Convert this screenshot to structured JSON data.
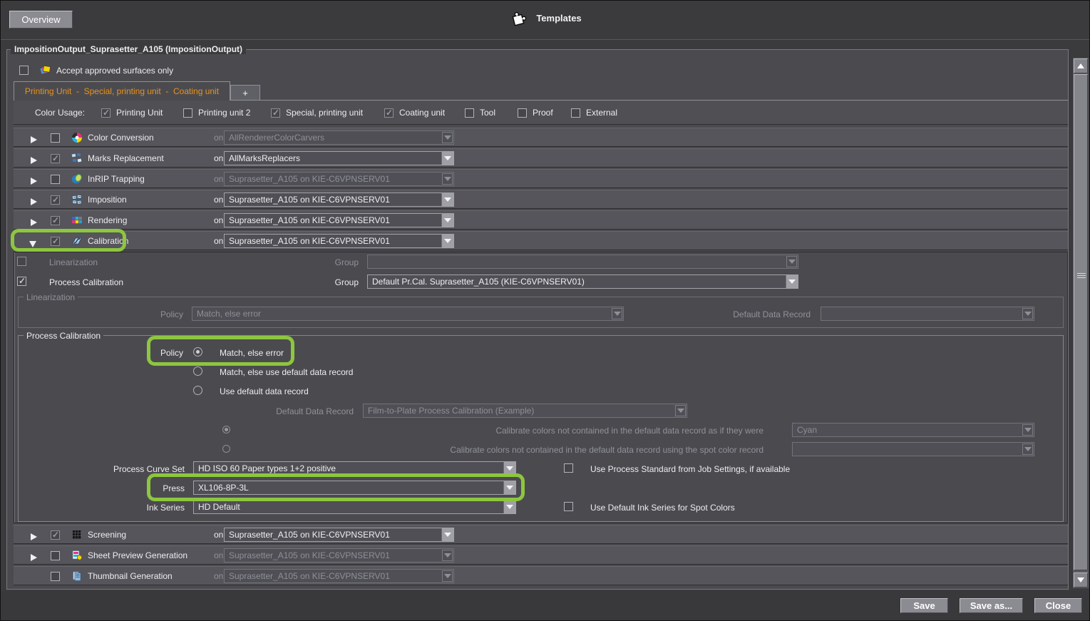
{
  "header": {
    "overview": "Overview",
    "templates": "Templates"
  },
  "panel": {
    "title": "ImpositionOutput_Suprasetter_A105 (ImpositionOutput)",
    "accept_approved": "Accept approved surfaces only"
  },
  "tabs": {
    "active_label": "Printing Unit  -  Special, printing unit  -  Coating unit",
    "add_label": "+"
  },
  "color_usage": {
    "label": "Color Usage:",
    "options": [
      {
        "label": "Printing Unit",
        "checked": true
      },
      {
        "label": "Printing unit 2",
        "checked": false
      },
      {
        "label": "Special, printing unit",
        "checked": true
      },
      {
        "label": "Coating unit",
        "checked": true
      },
      {
        "label": "Tool",
        "checked": false
      },
      {
        "label": "Proof",
        "checked": false
      },
      {
        "label": "External",
        "checked": false
      }
    ]
  },
  "on_label": "on",
  "rows_top": [
    {
      "label": "Color Conversion",
      "value": "AllRendererColorCarvers",
      "checked": false,
      "enabled": false,
      "expanded": false
    },
    {
      "label": "Marks Replacement",
      "value": "AllMarksReplacers",
      "checked": true,
      "enabled": true,
      "expanded": false
    },
    {
      "label": "InRIP Trapping",
      "value": "Suprasetter_A105 on KIE-C6VPNSERV01",
      "checked": false,
      "enabled": false,
      "expanded": false
    },
    {
      "label": "Imposition",
      "value": "Suprasetter_A105 on KIE-C6VPNSERV01",
      "checked": true,
      "enabled": true,
      "expanded": false
    },
    {
      "label": "Rendering",
      "value": "Suprasetter_A105 on KIE-C6VPNSERV01",
      "checked": true,
      "enabled": true,
      "expanded": false
    },
    {
      "label": "Calibration",
      "value": "Suprasetter_A105 on KIE-C6VPNSERV01",
      "checked": true,
      "enabled": true,
      "expanded": true,
      "highlighted": true
    }
  ],
  "calibration": {
    "linearization_row": {
      "label": "Linearization",
      "group_label": "Group",
      "value": "",
      "checked": false
    },
    "process_row": {
      "label": "Process Calibration",
      "group_label": "Group",
      "value": "Default Pr.Cal. Suprasetter_A105 (KIE-C6VPNSERV01)",
      "checked": true
    },
    "linearization_group": {
      "title": "Linearization",
      "policy_label": "Policy",
      "policy_value": "Match, else error",
      "default_data_record_label": "Default Data Record",
      "default_data_record_value": ""
    },
    "process_group": {
      "title": "Process Calibration",
      "policy_label": "Policy",
      "policy_options": [
        "Match, else error",
        "Match, else use default data record",
        "Use default data record"
      ],
      "policy_selected": "Match, else error",
      "default_data_record_label": "Default Data Record",
      "default_data_record_value": "Film-to-Plate Process Calibration (Example)",
      "calibrate_as_if_label": "Calibrate colors not contained in the default data record as if they were",
      "calibrate_as_if_value": "Cyan",
      "calibrate_spot_label": "Calibrate colors not contained in the default data record using the spot color record",
      "calibrate_spot_value": "",
      "process_curve_set_label": "Process Curve Set",
      "process_curve_set_value": "HD ISO 60 Paper types 1+2 positive",
      "use_process_standard_label": "Use Process Standard from Job Settings, if available",
      "press_label": "Press",
      "press_value": "XL106-8P-3L",
      "ink_series_label": "Ink Series",
      "ink_series_value": "HD Default",
      "use_default_ink_label": "Use Default Ink Series for Spot Colors"
    }
  },
  "rows_bottom": [
    {
      "label": "Screening",
      "value": "Suprasetter_A105 on KIE-C6VPNSERV01",
      "checked": true,
      "enabled": true,
      "has_arrow": true
    },
    {
      "label": "Sheet Preview Generation",
      "value": "Suprasetter_A105 on KIE-C6VPNSERV01",
      "checked": false,
      "enabled": false,
      "has_arrow": true
    },
    {
      "label": "Thumbnail Generation",
      "value": "Suprasetter_A105 on KIE-C6VPNSERV01",
      "checked": false,
      "enabled": false,
      "has_arrow": false
    }
  ],
  "footer": {
    "save": "Save",
    "save_as": "Save as...",
    "close": "Close"
  },
  "colors": {
    "highlight_green": "#8dc63f",
    "tab_orange": "#e8921e",
    "panel_bg": "#4b4b4f"
  }
}
